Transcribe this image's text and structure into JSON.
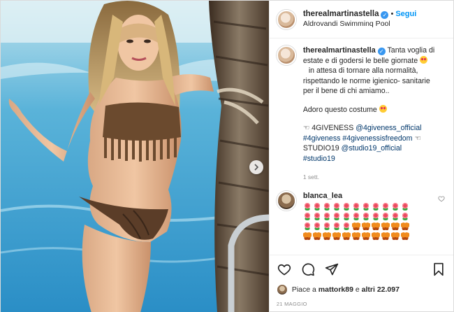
{
  "post": {
    "username": "therealmartinastella",
    "follow_label": "Segui",
    "separator": "•",
    "location": "Aldrovandi Swimminq Pool"
  },
  "caption": {
    "username": "therealmartinastella",
    "lines": [
      "Tanta voglia di",
      "estate e di godersi le belle giornate",
      "in attesa di tornare alla normalità,",
      "rispettando le norme igienico- sanitarie",
      "per il bene di chi amiamo..",
      "",
      "Adoro questo costume",
      "",
      "☜ 4GIVENESS",
      "@4giveness_official",
      "#4giveness",
      "#4givenessisfreedom",
      "☜",
      "STUDIO19",
      "@studio19_official",
      "#studio19"
    ],
    "time": "1 sett."
  },
  "comment": {
    "username": "blanca_lea",
    "emoji_rows": [
      [
        "flower",
        "flower",
        "flower",
        "flower",
        "flower",
        "flower",
        "flower",
        "flower",
        "flower",
        "flower",
        "flower"
      ],
      [
        "flower",
        "flower",
        "flower",
        "flower",
        "flower",
        "flower",
        "flower",
        "flower",
        "flower",
        "flower",
        "flower"
      ],
      [
        "flower",
        "flower",
        "flower",
        "flower",
        "flower",
        "butterfly",
        "butterfly",
        "butterfly",
        "butterfly",
        "butterfly",
        "butterfly"
      ],
      [
        "butterfly",
        "butterfly",
        "butterfly",
        "butterfly",
        "butterfly",
        "butterfly",
        "butterfly",
        "butterfly",
        "butterfly",
        "butterfly",
        "butterfly"
      ]
    ]
  },
  "actions": {
    "icons": [
      "heart-icon",
      "comment-icon",
      "share-icon",
      "bookmark-icon"
    ]
  },
  "likes": {
    "prefix": "Piace a",
    "user": "mattork89",
    "middle": "e",
    "others": "altri 22.097"
  },
  "date": "21 MAGGIO",
  "colors": {
    "link": "#0095f6",
    "hashtag": "#00376b",
    "muted": "#8e8e8e",
    "verified": "#3897f0"
  }
}
